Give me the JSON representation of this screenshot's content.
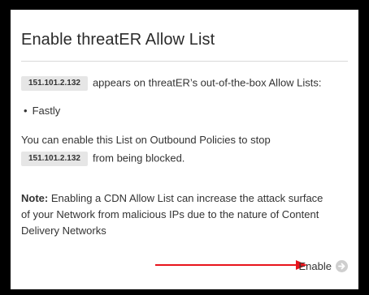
{
  "dialog": {
    "title": "Enable threatER Allow List",
    "ip": "151.101.2.132",
    "intro_text": "appears on threatER’s out-of-the-box Allow Lists:",
    "list_items": [
      "Fastly"
    ],
    "bullet": "•",
    "enable_text_1": "You can enable this List on Outbound Policies to stop",
    "enable_text_2": "from being blocked.",
    "note_label": "Note:",
    "note_text_1": "Enabling a CDN Allow List can increase the attack surface",
    "note_text_2": "of your Network from malicious IPs due to the nature of Content",
    "note_text_3": "Delivery Networks",
    "enable_button_label": "Enable"
  },
  "colors": {
    "arrow": "#e8141c",
    "enable_icon": "#cfcfcf",
    "chip_bg": "#e6e6e6"
  },
  "icons": {
    "enable_icon": "arrow-right-circle-icon",
    "annotation_arrow": "arrow-right-icon"
  }
}
